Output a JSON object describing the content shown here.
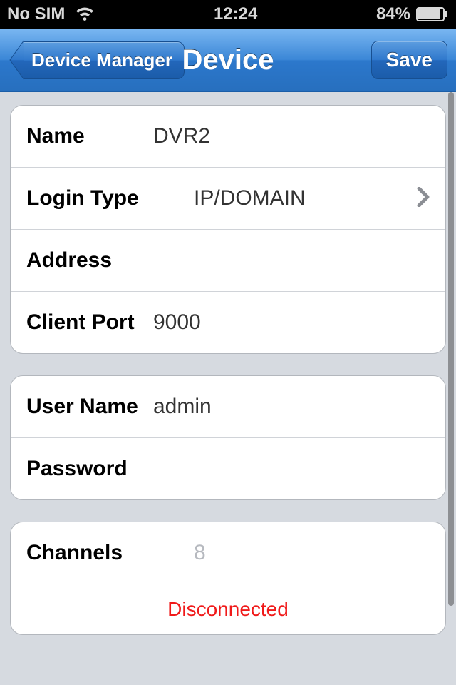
{
  "statusbar": {
    "sim": "No SIM",
    "time": "12:24",
    "battery": "84%"
  },
  "nav": {
    "back": "Device Manager",
    "title": "Device",
    "save": "Save"
  },
  "group1": {
    "name": {
      "label": "Name",
      "value": "DVR2"
    },
    "loginType": {
      "label": "Login Type",
      "value": "IP/DOMAIN"
    },
    "address": {
      "label": "Address",
      "value": ""
    },
    "clientPort": {
      "label": "Client Port",
      "value": "9000"
    }
  },
  "group2": {
    "userName": {
      "label": "User Name",
      "value": "admin"
    },
    "password": {
      "label": "Password",
      "value": ""
    }
  },
  "group3": {
    "channels": {
      "label": "Channels",
      "value": "8"
    },
    "status": "Disconnected"
  }
}
